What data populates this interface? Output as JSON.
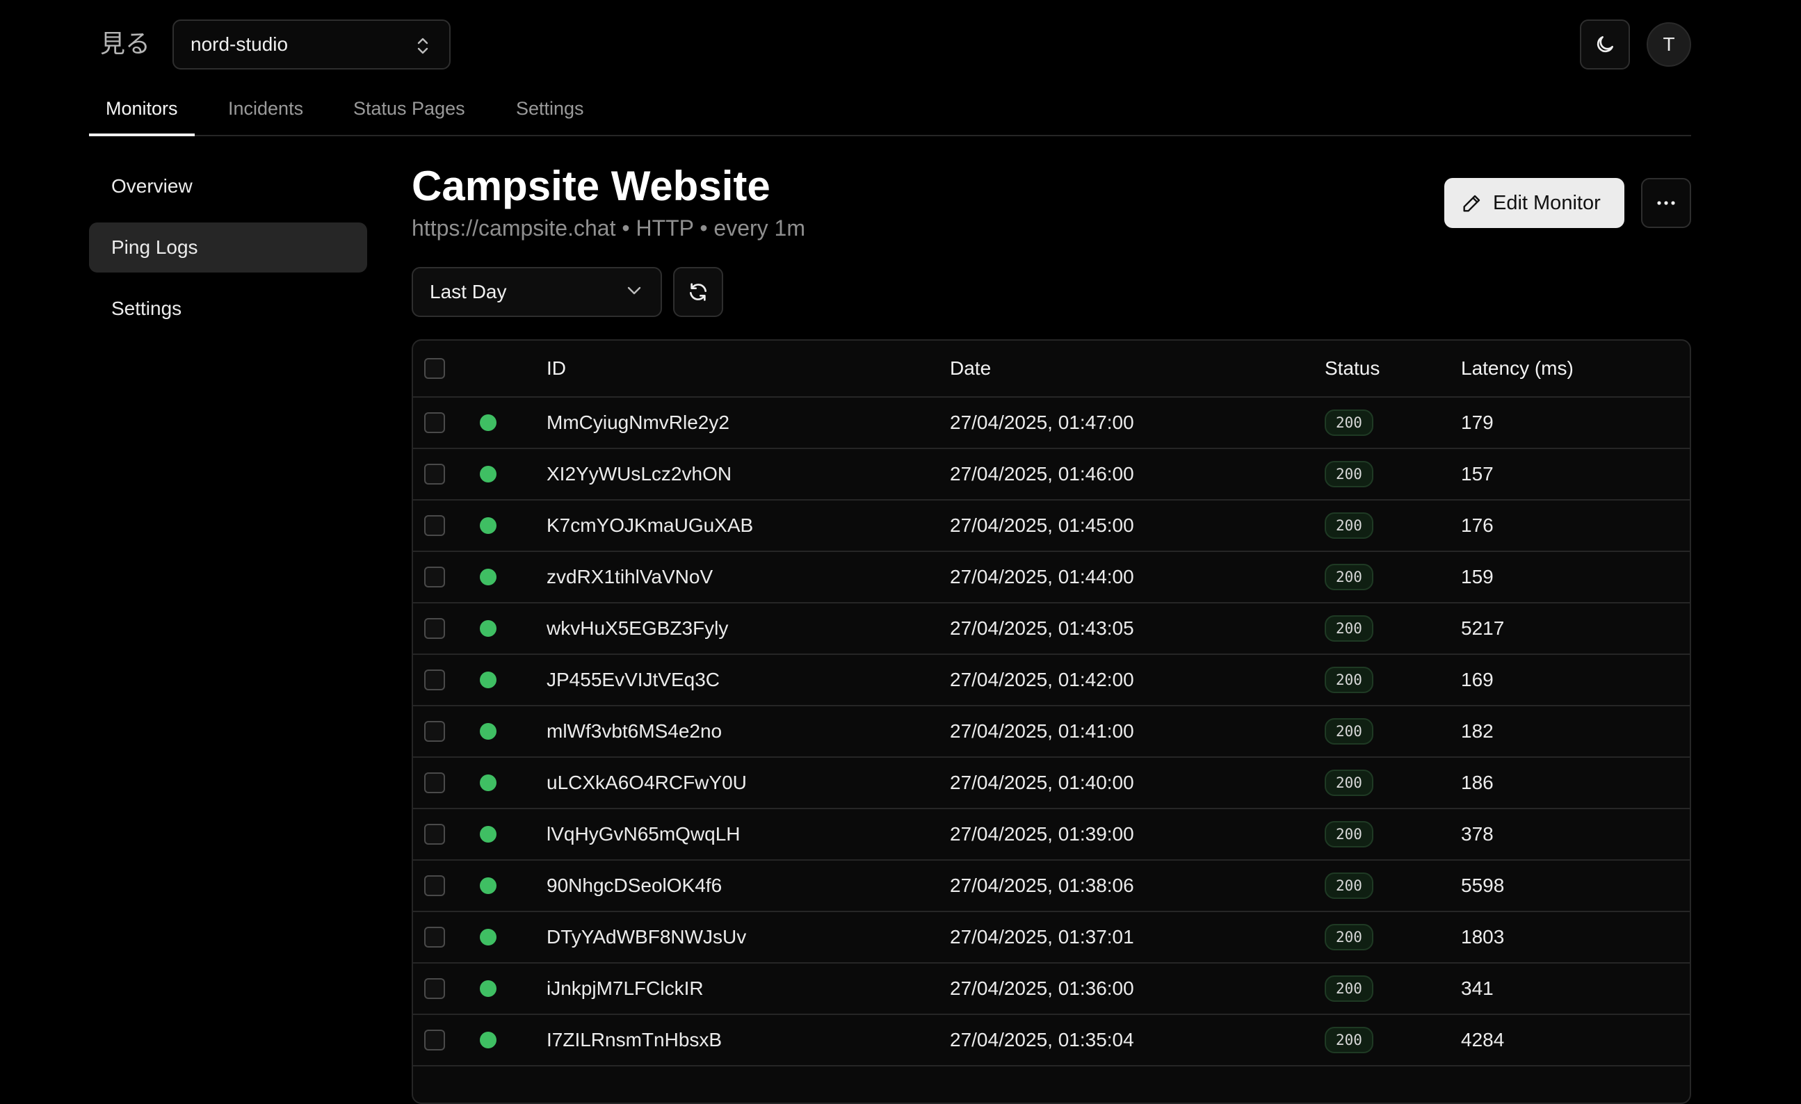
{
  "header": {
    "logo": "見る",
    "org": "nord-studio",
    "avatar_initial": "T"
  },
  "tabs": [
    {
      "label": "Monitors",
      "active": true
    },
    {
      "label": "Incidents",
      "active": false
    },
    {
      "label": "Status Pages",
      "active": false
    },
    {
      "label": "Settings",
      "active": false
    }
  ],
  "sidebar": {
    "items": [
      {
        "label": "Overview",
        "active": false
      },
      {
        "label": "Ping Logs",
        "active": true
      },
      {
        "label": "Settings",
        "active": false
      }
    ]
  },
  "monitor": {
    "title": "Campsite Website",
    "subtitle": "https://campsite.chat • HTTP • every 1m",
    "edit_label": "Edit Monitor"
  },
  "filter": {
    "range": "Last Day"
  },
  "table": {
    "columns": {
      "id": "ID",
      "date": "Date",
      "status": "Status",
      "latency": "Latency (ms)"
    },
    "rows": [
      {
        "id": "MmCyiugNmvRle2y2",
        "date": "27/04/2025, 01:47:00",
        "status": "200",
        "latency": "179"
      },
      {
        "id": "XI2YyWUsLcz2vhON",
        "date": "27/04/2025, 01:46:00",
        "status": "200",
        "latency": "157"
      },
      {
        "id": "K7cmYOJKmaUGuXAB",
        "date": "27/04/2025, 01:45:00",
        "status": "200",
        "latency": "176"
      },
      {
        "id": "zvdRX1tihlVaVNoV",
        "date": "27/04/2025, 01:44:00",
        "status": "200",
        "latency": "159"
      },
      {
        "id": "wkvHuX5EGBZ3Fyly",
        "date": "27/04/2025, 01:43:05",
        "status": "200",
        "latency": "5217"
      },
      {
        "id": "JP455EvVIJtVEq3C",
        "date": "27/04/2025, 01:42:00",
        "status": "200",
        "latency": "169"
      },
      {
        "id": "mlWf3vbt6MS4e2no",
        "date": "27/04/2025, 01:41:00",
        "status": "200",
        "latency": "182"
      },
      {
        "id": "uLCXkA6O4RCFwY0U",
        "date": "27/04/2025, 01:40:00",
        "status": "200",
        "latency": "186"
      },
      {
        "id": "lVqHyGvN65mQwqLH",
        "date": "27/04/2025, 01:39:00",
        "status": "200",
        "latency": "378"
      },
      {
        "id": "90NhgcDSeolOK4f6",
        "date": "27/04/2025, 01:38:06",
        "status": "200",
        "latency": "5598"
      },
      {
        "id": "DTyYAdWBF8NWJsUv",
        "date": "27/04/2025, 01:37:01",
        "status": "200",
        "latency": "1803"
      },
      {
        "id": "iJnkpjM7LFClckIR",
        "date": "27/04/2025, 01:36:00",
        "status": "200",
        "latency": "341"
      },
      {
        "id": "I7ZILRnsmTnHbsxB",
        "date": "27/04/2025, 01:35:04",
        "status": "200",
        "latency": "4284"
      }
    ]
  },
  "colors": {
    "success_dot": "#3fbf63",
    "background": "#000000"
  }
}
